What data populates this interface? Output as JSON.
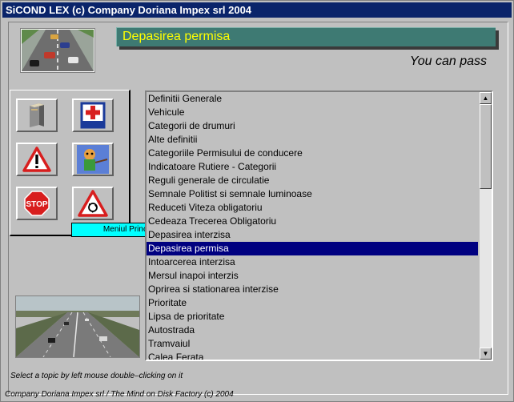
{
  "window": {
    "title": "SiCOND LEX (c) Company Doriana Impex srl 2004"
  },
  "header": {
    "topic_title": "Depasirea permisa",
    "translation": "You can pass"
  },
  "toolbar": {
    "buttons": [
      {
        "icon": "book-icon"
      },
      {
        "icon": "first-aid-icon"
      },
      {
        "icon": "warning-sign-icon"
      },
      {
        "icon": "instructor-icon"
      },
      {
        "icon": "stop-sign-icon"
      },
      {
        "icon": "roundabout-sign-icon"
      }
    ],
    "tooltip": "Meniul Principal !"
  },
  "topics": {
    "selected_index": 13,
    "items": [
      "Definitii Generale",
      "Vehicule",
      "Categorii de drumuri",
      "Alte definitii",
      "Categoriile Permisului de conducere",
      "Indicatoare Rutiere - Categorii",
      "Reguli generale de circulatie",
      "Semnale Politist si semnale luminoase",
      "Reduceti Viteza obligatoriu",
      "Cedeaza Trecerea Obligatoriu",
      "Depasirea interzisa",
      "Depasirea permisa",
      "Intoarcerea interzisa",
      "Mersul inapoi interzis",
      "Oprirea si stationarea interzise",
      "Prioritate",
      "Lipsa de prioritate",
      "Autostrada",
      "Tramvaiul",
      "Calea Ferata"
    ]
  },
  "status": {
    "hint": "Select a topic by left mouse double–clicking on it",
    "footer": "Company Doriana Impex srl / The Mind on Disk Factory (c) 2004"
  }
}
